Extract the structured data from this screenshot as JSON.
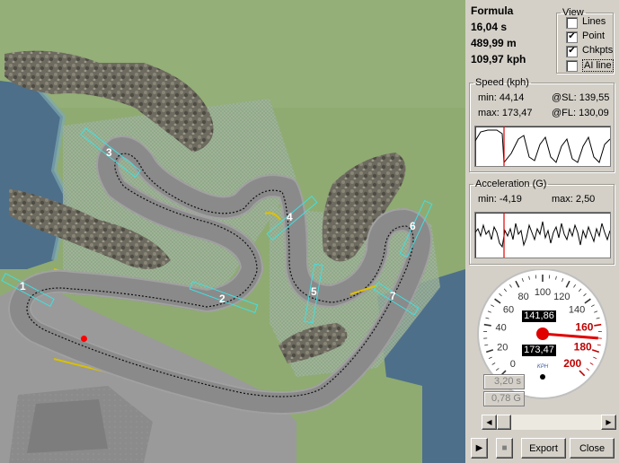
{
  "car": {
    "name": "Formula",
    "time": "16,04 s",
    "distance": "489,99 m",
    "speed": "109,97 kph"
  },
  "view": {
    "title": "View",
    "options": [
      {
        "label": "Lines",
        "checked": false
      },
      {
        "label": "Point",
        "checked": true
      },
      {
        "label": "Chkpts",
        "checked": true
      },
      {
        "label": "AI line",
        "checked": false
      }
    ]
  },
  "speed_panel": {
    "title": "Speed (kph)",
    "min_label": "min: 44,14",
    "max_label": "max: 173,47",
    "sl_label": "@SL: 139,55",
    "fl_label": "@FL: 130,09"
  },
  "accel_panel": {
    "title": "Acceleration (G)",
    "min_label": "min: -4,19",
    "max_label": "max: 2,50"
  },
  "speedometer": {
    "unit": "KPH",
    "ticks": [
      "0",
      "20",
      "40",
      "60",
      "80",
      "100",
      "120",
      "140",
      "160",
      "180",
      "200"
    ],
    "display_top": "141,86",
    "display_bottom": "173,47",
    "needle_value": 170
  },
  "readouts": {
    "time": "3,20 s",
    "g": "0,78 G"
  },
  "buttons": {
    "play": "▶",
    "stop": "■",
    "export": "Export",
    "close": "Close"
  },
  "checkpoints": [
    "1",
    "2",
    "3",
    "4",
    "5",
    "6",
    "7"
  ],
  "colors": {
    "needle": "#e00000",
    "point": "#ff0000",
    "checkpoint": "#40e0e0"
  }
}
